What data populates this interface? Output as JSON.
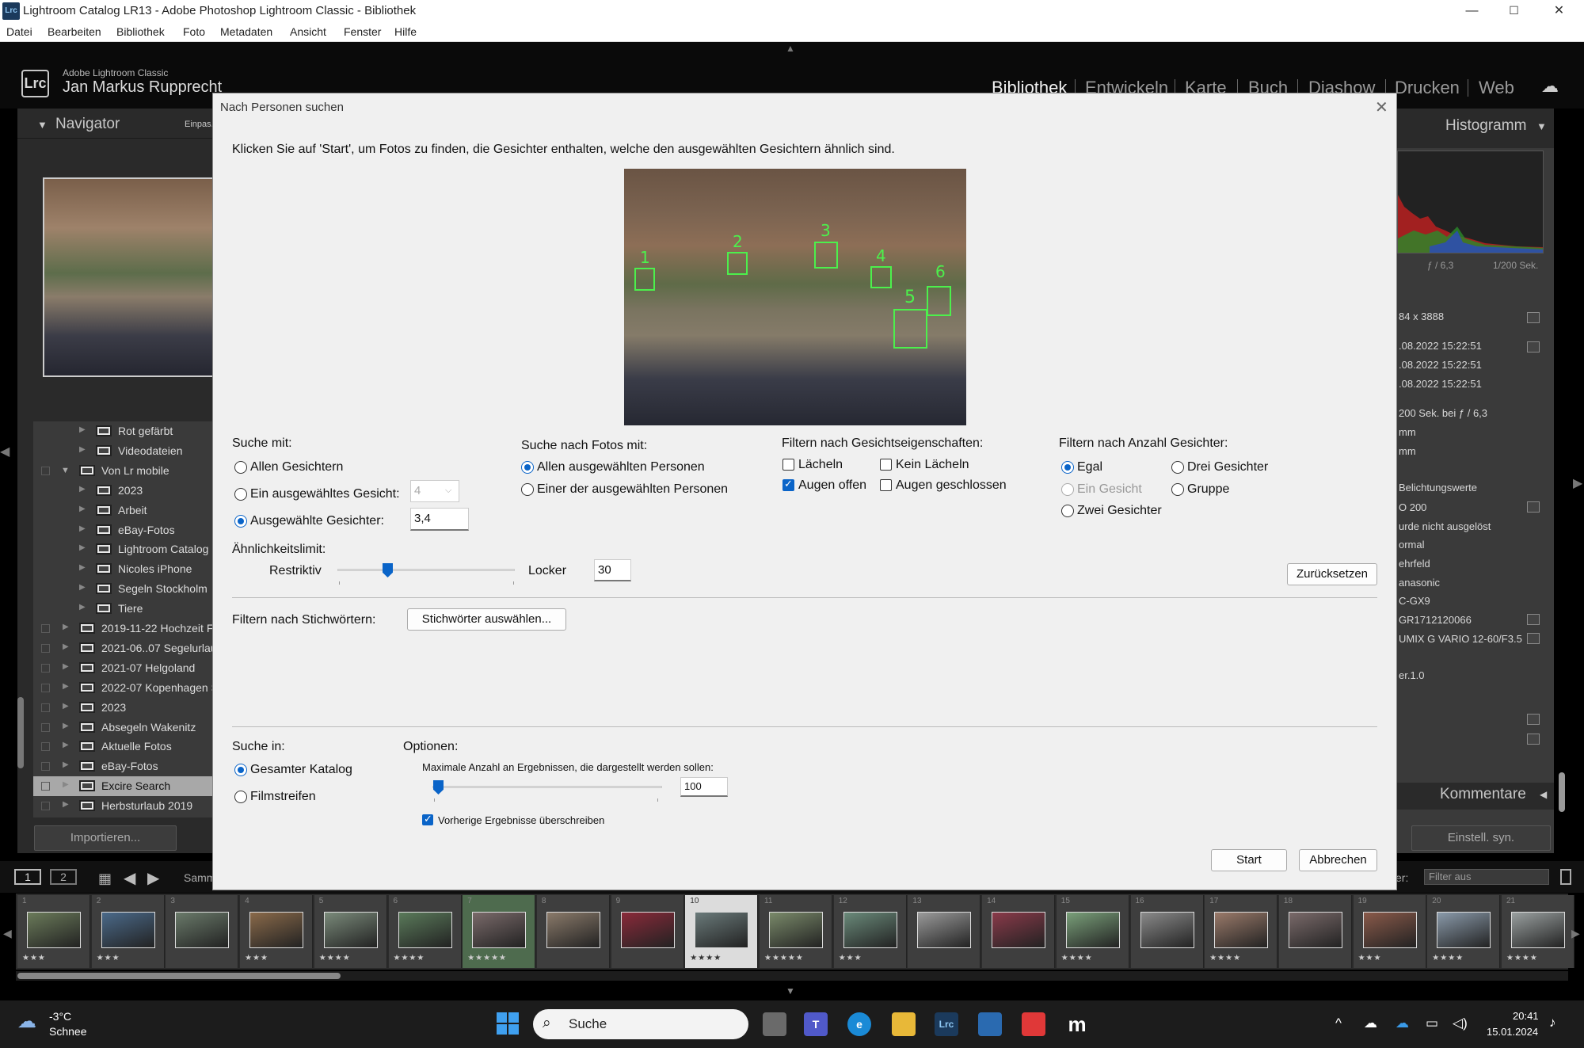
{
  "window": {
    "title": "Lightroom Catalog LR13 - Adobe Photoshop Lightroom Classic - Bibliothek",
    "app_icon": "Lrc",
    "controls": {
      "minimize": "—",
      "maximize": "☐",
      "close": "✕"
    }
  },
  "menu": [
    "Datei",
    "Bearbeiten",
    "Bibliothek",
    "Foto",
    "Metadaten",
    "Ansicht",
    "Fenster",
    "Hilfe"
  ],
  "identity": {
    "logo": "Lrc",
    "product": "Adobe Lightroom Classic",
    "user": "Jan Markus Rupprecht"
  },
  "modules": [
    "Bibliothek",
    "Entwickeln",
    "Karte",
    "Buch",
    "Diashow",
    "Drucken",
    "Web"
  ],
  "left_panel": {
    "navigator_title": "Navigator",
    "navigator_fit": "Einpas.",
    "folders": [
      {
        "label": "Rot gefärbt",
        "indent": 3
      },
      {
        "label": "Videodateien",
        "indent": 3
      },
      {
        "label": "Von Lr mobile",
        "indent": 2,
        "expanded": true
      },
      {
        "label": "2023",
        "indent": 3
      },
      {
        "label": "Arbeit",
        "indent": 3
      },
      {
        "label": "eBay-Fotos",
        "indent": 3
      },
      {
        "label": "Lightroom Catalog",
        "indent": 3
      },
      {
        "label": "Nicoles iPhone",
        "indent": 3
      },
      {
        "label": "Segeln Stockholm",
        "indent": 3
      },
      {
        "label": "Tiere",
        "indent": 3
      },
      {
        "label": "2019-11-22 Hochzeit Fl",
        "indent": 1
      },
      {
        "label": "2021-06..07 Segelurlau",
        "indent": 1
      },
      {
        "label": "2021-07 Helgoland",
        "indent": 1
      },
      {
        "label": "2022-07 Kopenhagen S",
        "indent": 1
      },
      {
        "label": "2023",
        "indent": 1
      },
      {
        "label": "Absegeln Wakenitz",
        "indent": 1
      },
      {
        "label": "Aktuelle Fotos",
        "indent": 1
      },
      {
        "label": "eBay-Fotos",
        "indent": 1
      },
      {
        "label": "Excire Search",
        "indent": 1,
        "selected": true
      },
      {
        "label": "Herbsturlaub 2019",
        "indent": 1
      }
    ],
    "import_button": "Importieren..."
  },
  "right_panel": {
    "histogram_title": "Histogramm",
    "aperture": "ƒ / 6,3",
    "shutter": "1/200 Sek.",
    "metadata": [
      "84 x 3888",
      ".08.2022 15:22:51",
      ".08.2022 15:22:51",
      ".08.2022 15:22:51",
      "200 Sek. bei ƒ / 6,3",
      " mm",
      " mm",
      "Belichtungswerte",
      "O 200",
      "urde nicht ausgelöst",
      "ormal",
      "ehrfeld",
      "anasonic",
      "C-GX9",
      "GR1712120066",
      "UMIX G VARIO 12-60/F3.5",
      "er.1.0"
    ],
    "comments_title": "Kommentare",
    "sync_button": "Einstell. syn."
  },
  "filmstrip_toolbar": {
    "view1": "1",
    "view2": "2",
    "source": "Samm",
    "filter_label": "er:",
    "filter_value": "Filter aus"
  },
  "filmstrip": [
    {
      "n": "1",
      "stars": "★★★"
    },
    {
      "n": "2",
      "stars": "★★★"
    },
    {
      "n": "3",
      "stars": ""
    },
    {
      "n": "4",
      "stars": "★★★"
    },
    {
      "n": "5",
      "stars": "★★★★"
    },
    {
      "n": "6",
      "stars": "★★★★"
    },
    {
      "n": "7",
      "stars": "★★★★★"
    },
    {
      "n": "8",
      "stars": ""
    },
    {
      "n": "9",
      "stars": ""
    },
    {
      "n": "10",
      "stars": "★★★★"
    },
    {
      "n": "11",
      "stars": "★★★★★"
    },
    {
      "n": "12",
      "stars": "★★★"
    },
    {
      "n": "13",
      "stars": ""
    },
    {
      "n": "14",
      "stars": ""
    },
    {
      "n": "15",
      "stars": "★★★★"
    },
    {
      "n": "16",
      "stars": ""
    },
    {
      "n": "17",
      "stars": "★★★★"
    },
    {
      "n": "18",
      "stars": ""
    },
    {
      "n": "19",
      "stars": "★★★"
    },
    {
      "n": "20",
      "stars": "★★★★"
    },
    {
      "n": "21",
      "stars": "★★★★"
    }
  ],
  "dialog": {
    "title": "Nach Personen suchen",
    "instruction": "Klicken Sie auf 'Start', um Fotos zu finden, die Gesichter enthalten, welche den ausgewählten Gesichtern ähnlich sind.",
    "face_labels": [
      "1",
      "2",
      "3",
      "4",
      "5",
      "6"
    ],
    "search_with": {
      "title": "Suche mit:",
      "options": [
        "Allen Gesichtern",
        "Ein ausgewähltes Gesicht:",
        "Ausgewählte Gesichter:"
      ],
      "selected_index": 2,
      "single_face_value": "4",
      "faces_value": "3,4"
    },
    "search_photos": {
      "title": "Suche nach Fotos mit:",
      "options": [
        "Allen ausgewählten Personen",
        "Einer der ausgewählten Personen"
      ],
      "selected_index": 0
    },
    "face_props": {
      "title": "Filtern nach Gesichtseigenschaften:",
      "items": [
        {
          "label": "Lächeln",
          "checked": false
        },
        {
          "label": "Kein Lächeln",
          "checked": false
        },
        {
          "label": "Augen offen",
          "checked": true
        },
        {
          "label": "Augen geschlossen",
          "checked": false
        }
      ]
    },
    "face_count": {
      "title": "Filtern nach Anzahl Gesichter:",
      "options": [
        "Egal",
        "Drei Gesichter",
        "Ein Gesicht",
        "Gruppe",
        "Zwei Gesichter"
      ],
      "selected_index": 0
    },
    "similarity": {
      "title": "Ähnlichkeitslimit:",
      "left": "Restriktiv",
      "right": "Locker",
      "value": "30"
    },
    "reset_button": "Zurücksetzen",
    "keywords": {
      "label": "Filtern nach Stichwörtern:",
      "button": "Stichwörter auswählen..."
    },
    "search_in": {
      "title": "Suche in:",
      "options": [
        "Gesamter Katalog",
        "Filmstreifen"
      ],
      "selected_index": 0
    },
    "options": {
      "title": "Optionen:",
      "max_label": "Maximale Anzahl an Ergebnissen, die dargestellt werden sollen:",
      "max_value": "100",
      "overwrite_label": "Vorherige Ergebnisse überschreiben",
      "overwrite_checked": true
    },
    "start_button": "Start",
    "cancel_button": "Abbrechen",
    "close_icon": "✕"
  },
  "taskbar": {
    "temperature": "-3°C",
    "weather": "Schnee",
    "search": "Suche",
    "time": "20:41",
    "date": "15.01.2024"
  }
}
